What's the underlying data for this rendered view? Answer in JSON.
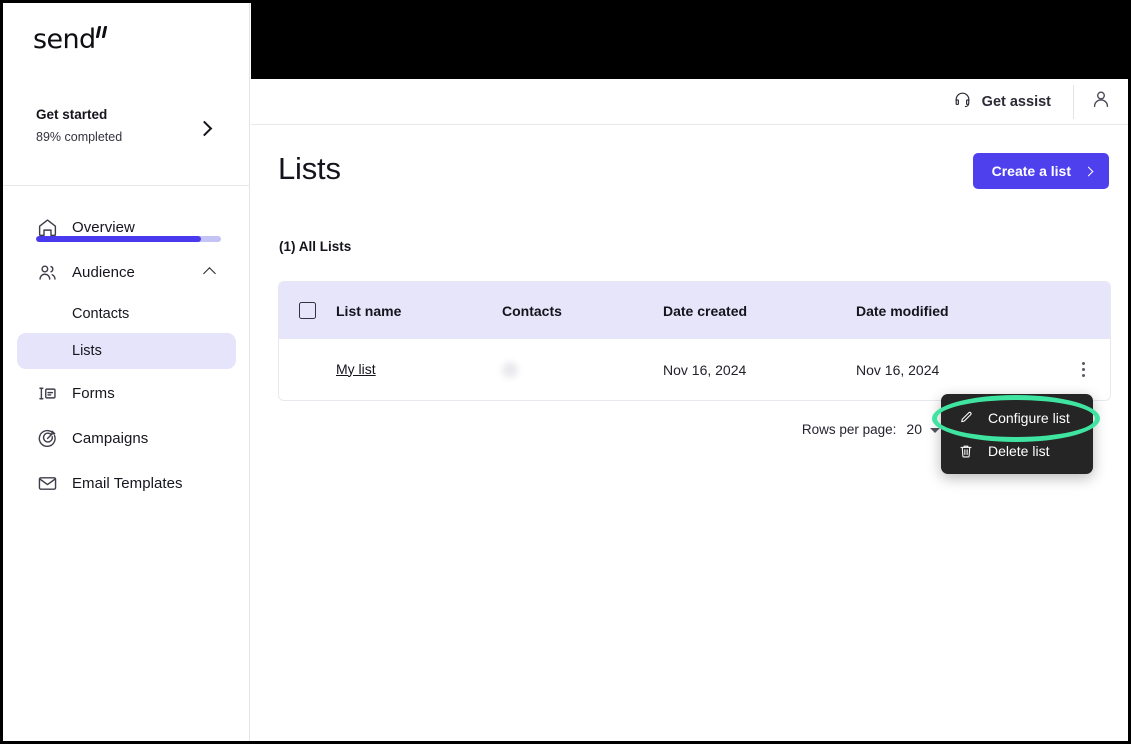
{
  "brand": {
    "logo_text": "send",
    "accent_color": "#4f40ee",
    "highlight_color": "#3fe4a0"
  },
  "sidebar": {
    "get_started": {
      "title": "Get started",
      "subtitle": "89% completed",
      "progress_percent": 89,
      "chevron_icon": "chevron-right-icon"
    },
    "items": [
      {
        "label": "Overview",
        "icon": "home-icon",
        "active": false
      },
      {
        "label": "Audience",
        "icon": "users-icon",
        "active": false,
        "expanded": true,
        "caret_icon": "chevron-up-icon"
      },
      {
        "label": "Forms",
        "icon": "form-icon",
        "active": false
      },
      {
        "label": "Campaigns",
        "icon": "target-icon",
        "active": false
      },
      {
        "label": "Email Templates",
        "icon": "envelope-icon",
        "active": false
      }
    ],
    "audience_children": [
      {
        "label": "Contacts",
        "active": false
      },
      {
        "label": "Lists",
        "active": true
      }
    ]
  },
  "topbar": {
    "assist_label": "Get assist",
    "assist_icon": "headset-icon",
    "avatar_icon": "user-avatar-icon"
  },
  "page": {
    "title": "Lists",
    "create_button_label": "Create a list",
    "create_button_chevron": "chevron-right-icon",
    "section_label": "(1) All Lists"
  },
  "table": {
    "columns": [
      "List name",
      "Contacts",
      "Date created",
      "Date modified"
    ],
    "select_all_checkbox": "checkbox-icon",
    "rows": [
      {
        "name": "My list",
        "contacts": "",
        "date_created": "Nov 16, 2024",
        "date_modified": "Nov 16, 2024",
        "actions_icon": "kebab-menu-icon"
      }
    ]
  },
  "pagination": {
    "rows_per_page_label": "Rows per page:",
    "rows_per_page_value": "20",
    "caret_icon": "caret-down-icon"
  },
  "context_menu": {
    "items": [
      {
        "label": "Configure list",
        "icon": "pencil-icon",
        "highlighted": true
      },
      {
        "label": "Delete list",
        "icon": "trash-icon",
        "highlighted": false
      }
    ]
  }
}
